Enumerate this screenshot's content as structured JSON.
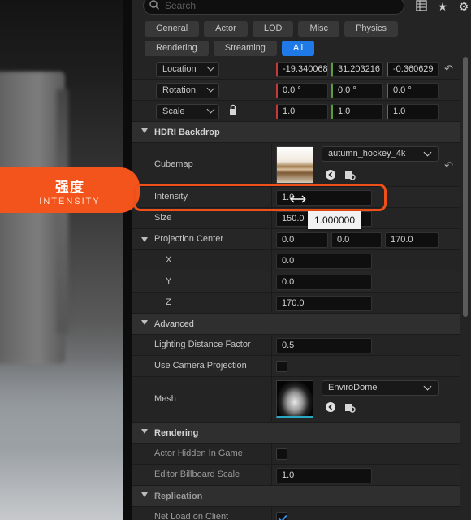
{
  "overlay": {
    "title_cn": "强度",
    "title_en": "INTENSITY"
  },
  "search": {
    "placeholder": "Search"
  },
  "toolbar": {
    "icons": [
      "grid-icon",
      "star-icon",
      "settings-icon"
    ]
  },
  "filters": {
    "row1": [
      "General",
      "Actor",
      "LOD",
      "Misc",
      "Physics"
    ],
    "row2": [
      "Rendering",
      "Streaming",
      "All"
    ],
    "active": "All"
  },
  "transform": {
    "location": {
      "label": "Location",
      "x": "-19.340068",
      "y": "31.203216",
      "z": "-0.360629"
    },
    "rotation": {
      "label": "Rotation",
      "x": "0.0 °",
      "y": "0.0 °",
      "z": "0.0 °"
    },
    "scale": {
      "label": "Scale",
      "x": "1.0",
      "y": "1.0",
      "z": "1.0"
    }
  },
  "hdri": {
    "section": "HDRI Backdrop",
    "cubemap_label": "Cubemap",
    "cubemap_value": "autumn_hockey_4k",
    "intensity_label": "Intensity",
    "intensity_value": "1.0",
    "size_label": "Size",
    "size_value": "150.0",
    "projection_label": "Projection Center",
    "projection": {
      "a": "0.0",
      "b": "0.0",
      "c": "170.0"
    },
    "x_label": "X",
    "x_value": "0.0",
    "y_label": "Y",
    "y_value": "0.0",
    "z_label": "Z",
    "z_value": "170.0"
  },
  "tooltip": {
    "value": "1.000000"
  },
  "advanced": {
    "section": "Advanced",
    "ldf_label": "Lighting Distance Factor",
    "ldf_value": "0.5",
    "ucp_label": "Use Camera Projection",
    "ucp_checked": false,
    "mesh_label": "Mesh",
    "mesh_value": "EnviroDome"
  },
  "rendering": {
    "section": "Rendering",
    "hidden_label": "Actor Hidden In Game",
    "hidden_checked": false,
    "billboard_label": "Editor Billboard Scale",
    "billboard_value": "1.0"
  },
  "replication": {
    "section": "Replication",
    "net_label": "Net Load on Client",
    "net_checked": true
  },
  "colors": {
    "accent": "#1f79e6",
    "highlight": "#f2541b"
  }
}
